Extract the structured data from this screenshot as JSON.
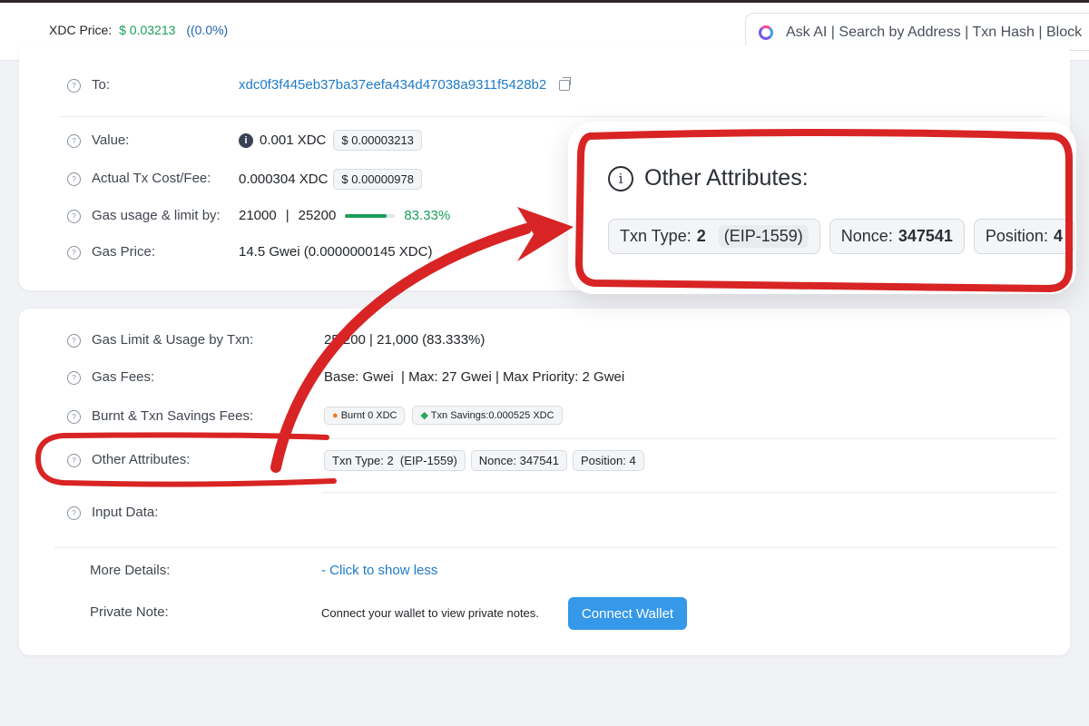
{
  "topbar": {
    "price_label": "XDC Price:",
    "price_usd": "$ 0.03213",
    "price_change": "((0.0%)",
    "search_placeholder": "Ask AI | Search by Address | Txn Hash | Block"
  },
  "overview": {
    "to": {
      "label": "To:",
      "address": "xdc0f3f445eb37ba37eefa434d47038a9311f5428b2"
    },
    "value": {
      "label": "Value:",
      "amount": "0.001 XDC",
      "usd": "$ 0.00003213"
    },
    "fee": {
      "label": "Actual Tx Cost/Fee:",
      "amount": "0.000304 XDC",
      "usd": "$ 0.00000978"
    },
    "gas_usage": {
      "label": "Gas usage & limit by:",
      "used": "21000",
      "separator": "|",
      "limit": "25200",
      "percent": "83.33%",
      "fill_fraction": 0.8333
    },
    "gas_price": {
      "label": "Gas Price:",
      "value": "14.5 Gwei (0.0000000145 XDC)"
    }
  },
  "details": {
    "gas_limit": {
      "label": "Gas Limit & Usage by Txn:",
      "value": "25,200 | 21,000 (83.333%)"
    },
    "gas_fees": {
      "label": "Gas Fees:",
      "value": "Base: Gwei  | Max: 27 Gwei | Max Priority: 2 Gwei"
    },
    "burnt": {
      "label": "Burnt & Txn Savings Fees:",
      "burnt": "Burnt 0 XDC",
      "savings": "Txn Savings:0.000525 XDC"
    },
    "other": {
      "label": "Other Attributes:",
      "txn_type": "Txn Type: 2  (EIP-1559)",
      "nonce": "Nonce: 347541",
      "position": "Position: 4"
    },
    "input": {
      "label": "Input Data:"
    },
    "more": {
      "label": "More Details:",
      "link": "- Click to show less"
    },
    "private_note": {
      "label": "Private Note:",
      "text": "Connect your wallet to view private notes.",
      "button": "Connect Wallet"
    }
  },
  "callout": {
    "title": "Other Attributes:",
    "txn_type_label": "Txn Type:",
    "txn_type_value": "2",
    "txn_type_sub": "(EIP-1559)",
    "nonce_label": "Nonce:",
    "nonce_value": "347541",
    "position_label": "Position:",
    "position_value": "4"
  },
  "colors": {
    "accent_red": "#d82424",
    "link_blue": "#1e7bc9",
    "success_green": "#1a9e58",
    "button_blue": "#3598e8"
  },
  "icons": [
    "help-circle-icon",
    "info-icon",
    "copy-icon",
    "flame-icon",
    "savings-icon",
    "ai-ring-icon",
    "arrow-annotation"
  ]
}
